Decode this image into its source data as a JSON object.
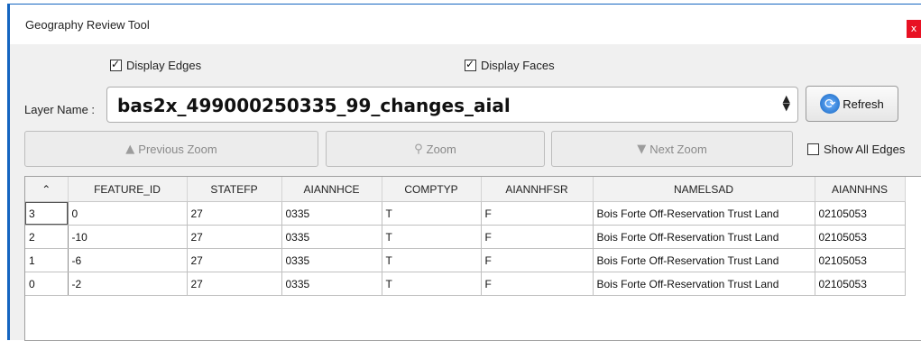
{
  "window": {
    "title": "Geography Review Tool",
    "close_label": "x"
  },
  "options": {
    "display_edges": "Display Edges",
    "display_faces": "Display Faces",
    "tick": "✓"
  },
  "layer": {
    "label": "Layer Name :",
    "value": "bas2x_499000250335_99_changes_aial",
    "spinner": "▲▼"
  },
  "toolbar": {
    "refresh_label": "Refresh",
    "previous_zoom": "Previous Zoom",
    "zoom": "Zoom",
    "next_zoom": "Next Zoom",
    "show_all_edges": "Show All Edges"
  },
  "icons": {
    "refresh": "⟳",
    "previous": "▲",
    "zoom": "⚲",
    "next": "▼",
    "sort": "⌃"
  },
  "table": {
    "columns": [
      "FEATURE_ID",
      "STATEFP",
      "AIANNHCE",
      "COMPTYP",
      "AIANNHFSR",
      "NAMELSAD",
      "AIANNHNS"
    ],
    "rows": [
      {
        "row": "3",
        "cells": [
          "0",
          "27",
          "0335",
          "T",
          "F",
          "Bois Forte Off-Reservation Trust Land",
          "02105053"
        ]
      },
      {
        "row": "2",
        "cells": [
          "-10",
          "27",
          "0335",
          "T",
          "F",
          "Bois Forte Off-Reservation Trust Land",
          "02105053"
        ]
      },
      {
        "row": "1",
        "cells": [
          "-6",
          "27",
          "0335",
          "T",
          "F",
          "Bois Forte Off-Reservation Trust Land",
          "02105053"
        ]
      },
      {
        "row": "0",
        "cells": [
          "-2",
          "27",
          "0335",
          "T",
          "F",
          "Bois Forte Off-Reservation Trust Land",
          "02105053"
        ]
      }
    ]
  },
  "colors": {
    "accent": "#1565c0",
    "close": "#e81123"
  }
}
